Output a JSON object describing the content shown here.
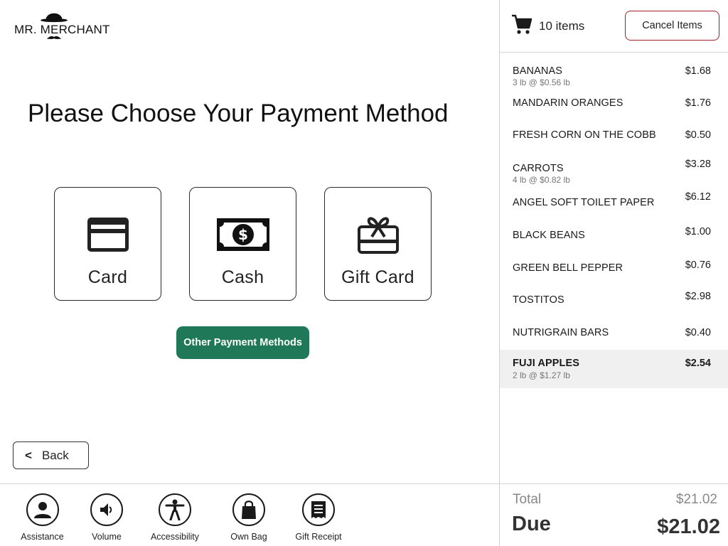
{
  "brand": {
    "name": "MR. MERCHANT"
  },
  "main": {
    "title": "Please Choose Your Payment Method",
    "payment_options": [
      {
        "label": "Card",
        "icon": "credit-card-icon"
      },
      {
        "label": "Cash",
        "icon": "cash-icon"
      },
      {
        "label": "Gift Card",
        "icon": "gift-card-icon"
      }
    ],
    "other_methods_label": "Other Payment Methods",
    "back_label": "Back",
    "accent_color": "#1f7857"
  },
  "toolbar": {
    "items": [
      {
        "label": "Assistance",
        "icon": "person-icon"
      },
      {
        "label": "Volume",
        "icon": "speaker-icon"
      },
      {
        "label": "Accessibility",
        "icon": "accessibility-icon"
      },
      {
        "label": "Own Bag",
        "icon": "bag-icon"
      },
      {
        "label": "Gift Receipt",
        "icon": "receipt-icon"
      }
    ]
  },
  "cart": {
    "count_label": "10 items",
    "cancel_label": "Cancel Items",
    "cancel_border_color": "#a11d2a",
    "items": [
      {
        "name": "BANANAS",
        "detail": "3 lb @ $0.56 lb",
        "price": "$1.68"
      },
      {
        "name": "MANDARIN ORANGES",
        "detail": "",
        "price": "$1.76"
      },
      {
        "name": "FRESH CORN ON THE COBB",
        "detail": "",
        "price": "$0.50"
      },
      {
        "name": "CARROTS",
        "detail": "4 lb @ $0.82 lb",
        "price": "$3.28"
      },
      {
        "name": "ANGEL SOFT TOILET PAPER",
        "detail": "",
        "price": "$6.12"
      },
      {
        "name": "BLACK BEANS",
        "detail": "",
        "price": "$1.00"
      },
      {
        "name": "GREEN BELL PEPPER",
        "detail": "",
        "price": "$0.76"
      },
      {
        "name": "TOSTITOS",
        "detail": "",
        "price": "$2.98"
      },
      {
        "name": "NUTRIGRAIN BARS",
        "detail": "",
        "price": "$0.40"
      },
      {
        "name": "FUJI APPLES",
        "detail": "2 lb @ $1.27 lb",
        "price": "$2.54",
        "selected": true
      }
    ],
    "total_label": "Total",
    "total_value": "$21.02",
    "due_label": "Due",
    "due_value": "$21.02"
  }
}
